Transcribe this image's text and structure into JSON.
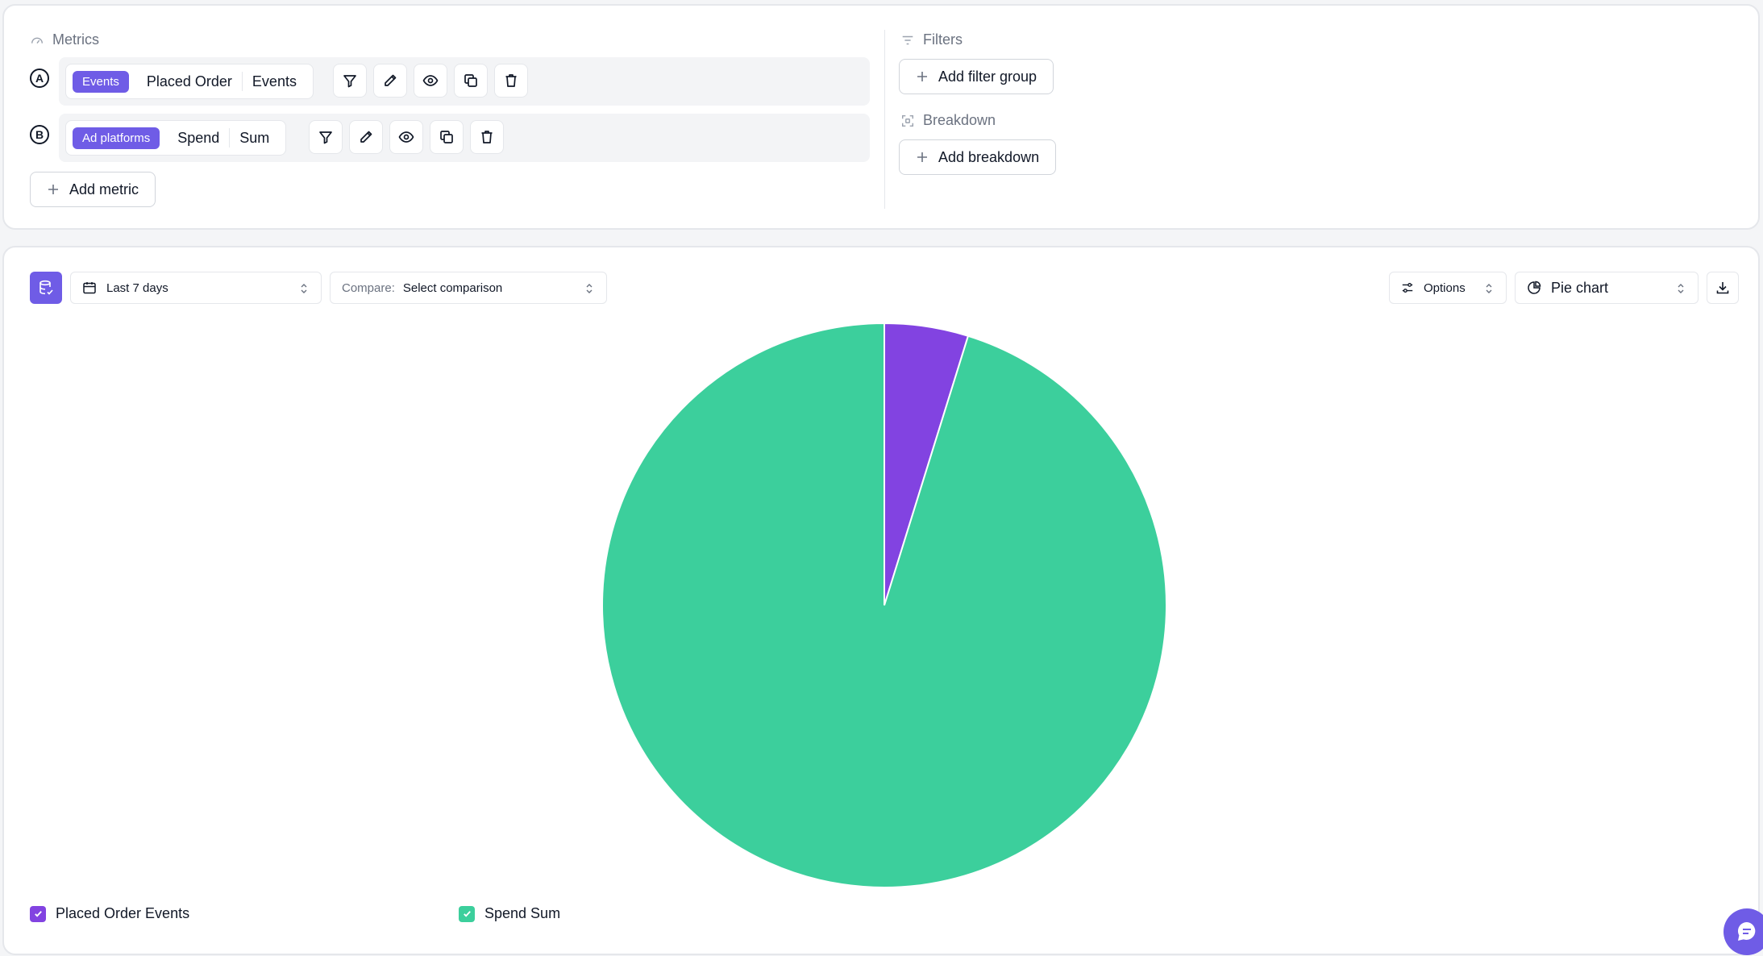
{
  "metrics": {
    "label": "Metrics",
    "add_label": "Add metric",
    "rows": [
      {
        "letter": "A",
        "tag": "Events",
        "name": "Placed Order",
        "aggregation": "Events"
      },
      {
        "letter": "B",
        "tag": "Ad platforms",
        "name": "Spend",
        "aggregation": "Sum"
      }
    ]
  },
  "filters": {
    "label": "Filters",
    "add_label": "Add filter group"
  },
  "breakdown": {
    "label": "Breakdown",
    "add_label": "Add breakdown"
  },
  "toolbar": {
    "date_range": "Last 7 days",
    "compare_label": "Compare:",
    "compare_value": "Select comparison",
    "options_label": "Options",
    "chart_type_label": "Pie chart"
  },
  "colors": {
    "accent": "#6f5ce6",
    "series_a": "#8243e1",
    "series_b": "#3ccf9c"
  },
  "chart_data": {
    "type": "pie",
    "categories": [
      "Placed Order Events",
      "Spend Sum"
    ],
    "values": [
      4.8,
      95.2
    ],
    "colors": [
      "#8243e1",
      "#3ccf9c"
    ],
    "legend": "bottom-left"
  }
}
